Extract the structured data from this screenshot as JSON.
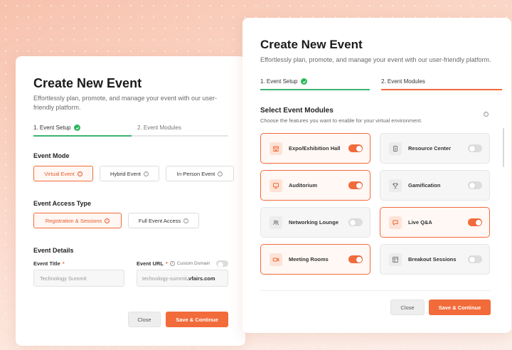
{
  "back": {
    "title": "Create New Event",
    "subtitle": "Effortlessly plan, promote, and manage your event with our user-friendly platform.",
    "steps": [
      "1. Event Setup",
      "2. Event Modules"
    ],
    "event_mode": {
      "heading": "Event Mode",
      "options": [
        "Virtual Event",
        "Hybrid Event",
        "In-Person Event"
      ],
      "selected": "Virtual Event"
    },
    "access": {
      "heading": "Event Access Type",
      "options": [
        "Registration & Sessions",
        "Full Event Access"
      ],
      "selected": "Registration & Sessions"
    },
    "details": {
      "heading": "Event Details",
      "title_label": "Event Title",
      "title_placeholder": "Technology Summit",
      "url_label": "Event URL",
      "custom_domain": "Custom Domain",
      "url_prefix": "technology-summit",
      "url_suffix": ".vfairs.com"
    },
    "close": "Close",
    "save": "Save & Continue"
  },
  "front": {
    "title": "Create New Event",
    "subtitle": "Effortlessly plan, promote, and manage your event with our user-friendly platform.",
    "steps": [
      "1. Event Setup",
      "2. Event Modules"
    ],
    "modules_heading": "Select Event Modules",
    "modules_sub": "Choose the features you want to enable for your virtual environment.",
    "modules": [
      {
        "name": "Expo/Exhibition Hall",
        "icon": "store-icon",
        "enabled": true
      },
      {
        "name": "Resource Center",
        "icon": "document-icon",
        "enabled": false
      },
      {
        "name": "Auditorium",
        "icon": "presentation-icon",
        "enabled": true
      },
      {
        "name": "Gamification",
        "icon": "trophy-icon",
        "enabled": false
      },
      {
        "name": "Networking Lounge",
        "icon": "users-icon",
        "enabled": false
      },
      {
        "name": "Live Q&A",
        "icon": "chat-icon",
        "enabled": true
      },
      {
        "name": "Meeting Rooms",
        "icon": "video-icon",
        "enabled": true
      },
      {
        "name": "Breakout Sessions",
        "icon": "layout-icon",
        "enabled": false
      }
    ],
    "close": "Close",
    "save": "Save & Continue"
  },
  "colors": {
    "accent": "#f26b3a",
    "success": "#2eb85c"
  }
}
